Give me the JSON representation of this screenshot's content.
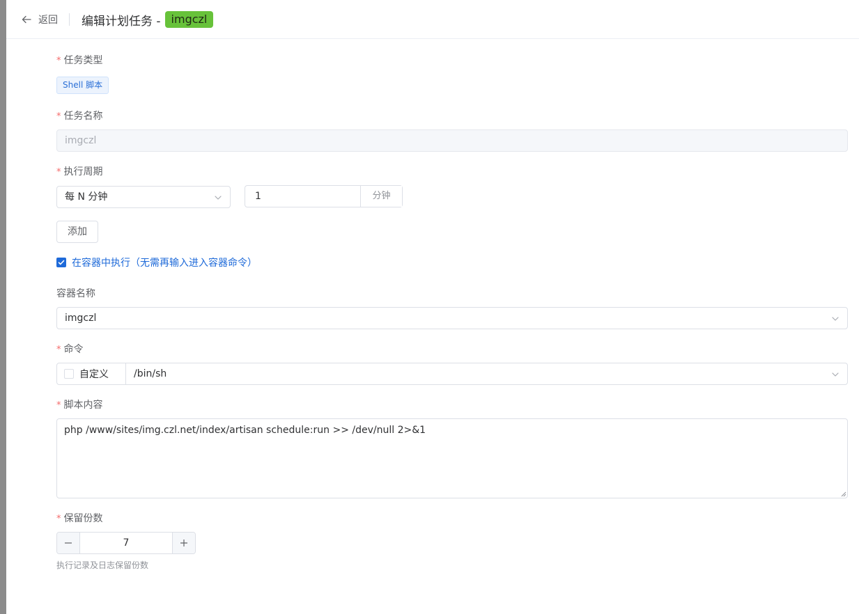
{
  "header": {
    "back_label": "返回",
    "title": "编辑计划任务 -",
    "title_tag": "imgczl"
  },
  "form": {
    "task_type": {
      "label": "任务类型",
      "value": "Shell 脚本"
    },
    "task_name": {
      "label": "任务名称",
      "value": "imgczl"
    },
    "period": {
      "label": "执行周期",
      "select_value": "每 N 分钟",
      "number": "1",
      "unit": "分钟",
      "add_button": "添加"
    },
    "in_container": {
      "checked": true,
      "label": "在容器中执行（无需再输入进入容器命令）"
    },
    "container_name": {
      "label": "容器名称",
      "value": "imgczl"
    },
    "command": {
      "label": "命令",
      "custom_label": "自定义",
      "custom_checked": false,
      "value": "/bin/sh"
    },
    "script": {
      "label": "脚本内容",
      "value": "php /www/sites/img.czl.net/index/artisan schedule:run >> /dev/null 2>&1"
    },
    "retain": {
      "label": "保留份数",
      "value": "7",
      "help": "执行记录及日志保留份数"
    }
  },
  "colors": {
    "primary": "#1e6ad9",
    "success": "#67c23a",
    "required": "#f56c6c"
  },
  "required_mark": "*"
}
